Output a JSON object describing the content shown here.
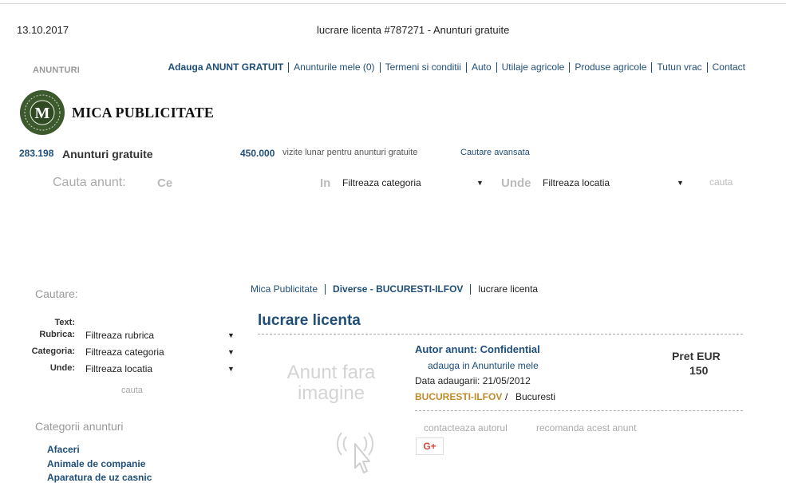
{
  "header": {
    "date": "13.10.2017",
    "page_title": "lucrare licenta #787271 - Anunturi gratuite",
    "section_label": "ANUNTURI"
  },
  "topnav": [
    "Adauga ANUNT GRATUIT",
    "Anunturile mele (0)",
    "Termeni si conditii",
    "Auto",
    "Utilaje agricole",
    "Produse agricole",
    "Tutun vrac",
    "Contact"
  ],
  "logo": {
    "text": "MICA PUBLICITATE",
    "badge_letter": "M"
  },
  "stats": {
    "count": "283.198",
    "count_label": "Anunturi gratuite",
    "visits": "450.000",
    "visits_label": "vizite lunar pentru anunturi gratuite",
    "advanced_search": "Cautare avansata"
  },
  "search": {
    "label": "Cauta anunt:",
    "what": "Ce",
    "in": "In",
    "category": "Filtreaza categoria",
    "where": "Unde",
    "location": "Filtreaza locatia",
    "button": "cauta"
  },
  "sidebar": {
    "title": "Cautare:",
    "form": {
      "text_label": "Text:",
      "rubric_label": "Rubrica:",
      "rubric_value": "Filtreaza rubrica",
      "category_label": "Categoria:",
      "category_value": "Filtreaza categoria",
      "where_label": "Unde:",
      "where_value": "Filtreaza locatia",
      "button": "cauta"
    },
    "categories_title": "Categorii anunturi",
    "categories": [
      "Afaceri",
      "Animale de companie",
      "Aparatura de uz casnic"
    ]
  },
  "breadcrumb": [
    "Mica Publicitate",
    "Diverse - BUCURESTI-ILFOV",
    "lucrare licenta"
  ],
  "ad": {
    "title": "lucrare licenta",
    "no_image": "Anunt fara imagine",
    "author": "Autor anunt: Confidential",
    "add_to_mine": "adauga in Anunturile mele",
    "date_added": "Data adaugarii: 21/05/2012",
    "region": "BUCURESTI-ILFOV",
    "separator": "/",
    "city": "Bucuresti",
    "price_label": "Pret EUR",
    "price_value": "150",
    "contact": "contacteaza autorul",
    "recommend": "recomanda acest anunt",
    "gplus": "G+"
  },
  "colors": {
    "link": "#1f4e79",
    "region": "#c08a2b",
    "logo_badge": "#3d5a2e"
  }
}
